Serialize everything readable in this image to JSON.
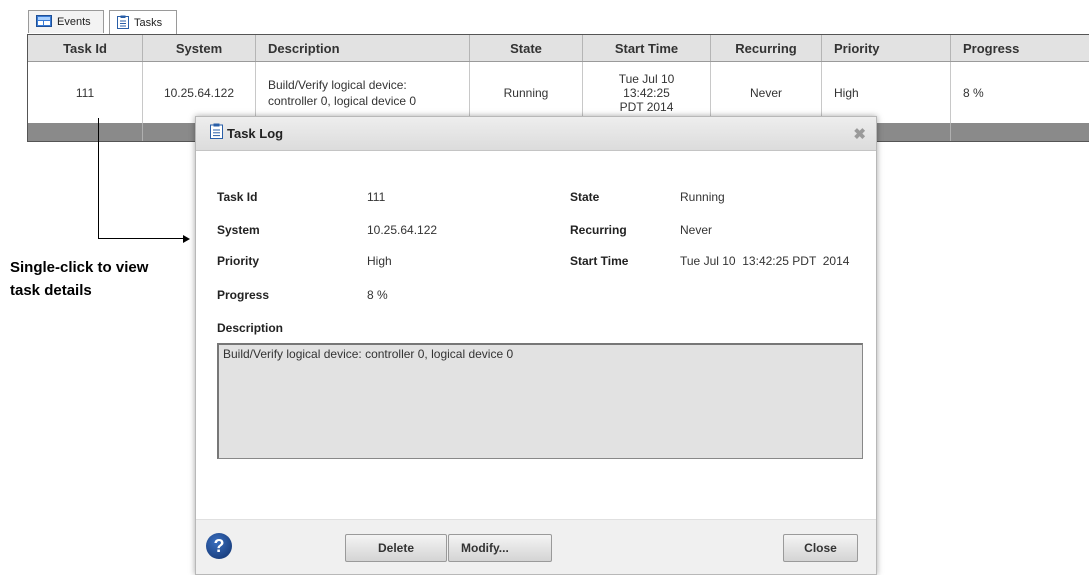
{
  "tabs": [
    {
      "label": "Events",
      "icon": "events-icon",
      "active": false
    },
    {
      "label": "Tasks",
      "icon": "tasks-clipboard-icon",
      "active": true
    }
  ],
  "table": {
    "columns": [
      "Task Id",
      "System",
      "Description",
      "State",
      "Start Time",
      "Recurring",
      "Priority",
      "Progress"
    ],
    "rows": [
      {
        "task_id": "111",
        "system": "10.25.64.122",
        "description_line1": "Build/Verify logical device:",
        "description_line2": "controller 0, logical device 0",
        "state": "Running",
        "start_line1": "Tue Jul 10",
        "start_line2": "13:42:25",
        "start_line3": "PDT 2014",
        "recurring": "Never",
        "priority": "High",
        "progress": "8 %"
      }
    ]
  },
  "callout": {
    "line1": "Single-click to view",
    "line2": "task details"
  },
  "dialog": {
    "title": "Task Log",
    "close_glyph": "✖",
    "fields": {
      "task_id_label": "Task Id",
      "task_id_value": "111",
      "system_label": "System",
      "system_value": "10.25.64.122",
      "priority_label": "Priority",
      "priority_value": "High",
      "progress_label": "Progress",
      "progress_value": "8 %",
      "state_label": "State",
      "state_value": "Running",
      "recurring_label": "Recurring",
      "recurring_value": "Never",
      "start_time_label": "Start Time",
      "start_time_value": "Tue Jul 10  13:42:25 PDT  2014"
    },
    "description_label": "Description",
    "description_text": "Build/Verify logical device: controller 0, logical device 0",
    "buttons": {
      "help": "?",
      "delete": "Delete",
      "modify": "Modify...",
      "close": "Close"
    }
  },
  "colors": {
    "header_bg": "#e2e2e2",
    "footer_bar": "#8a8a8a",
    "help_blue": "#1e4a94",
    "description_bg": "#e2e2e2"
  }
}
